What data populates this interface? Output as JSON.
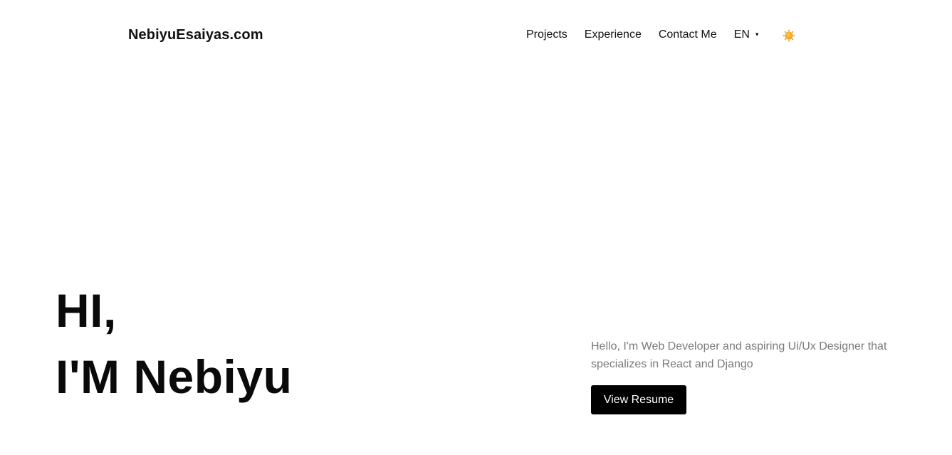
{
  "header": {
    "brand": "NebiyuEsaiyas.com",
    "nav": [
      {
        "label": "Projects"
      },
      {
        "label": "Experience"
      },
      {
        "label": "Contact Me"
      }
    ],
    "language": {
      "selected": "EN",
      "caret": "▾"
    },
    "theme_icon": "sun-icon",
    "theme_icon_color": "#f0a52a"
  },
  "hero": {
    "greeting": "HI,",
    "name_line": "I'M Nebiyu",
    "intro": "Hello, I'm Web Developer and aspiring Ui/Ux Designer that specializes in React and Django",
    "resume_button": "View Resume"
  },
  "colors": {
    "background": "#ffffff",
    "text": "#111111",
    "muted_text": "#7a7a7a",
    "button_bg": "#000000",
    "button_text": "#ffffff"
  }
}
